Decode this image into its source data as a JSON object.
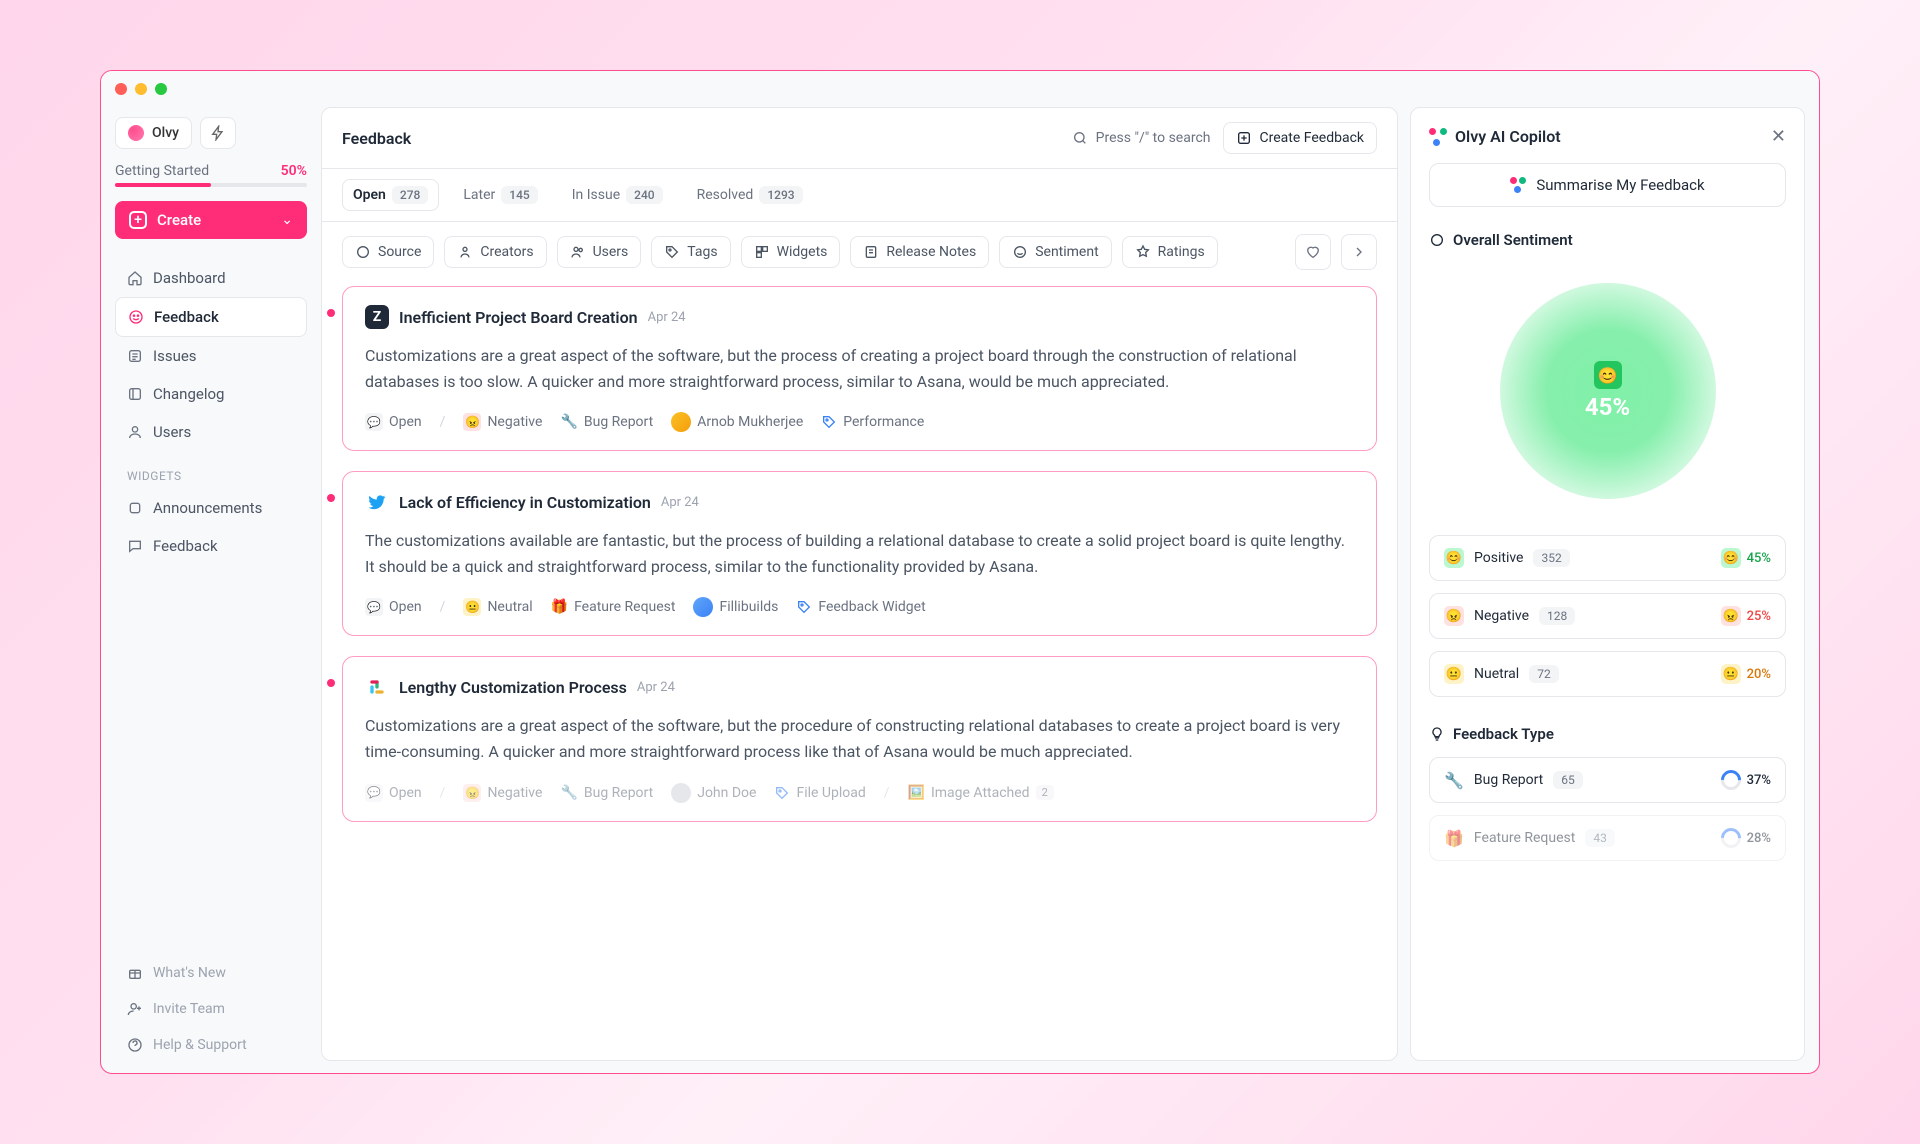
{
  "brand": "Olvy",
  "sidebar": {
    "getting_started": "Getting Started",
    "progress": "50%",
    "create": "Create",
    "nav": [
      {
        "label": "Dashboard"
      },
      {
        "label": "Feedback"
      },
      {
        "label": "Issues"
      },
      {
        "label": "Changelog"
      },
      {
        "label": "Users"
      }
    ],
    "widgets_header": "WIDGETS",
    "widgets": [
      {
        "label": "Announcements"
      },
      {
        "label": "Feedback"
      }
    ],
    "footer": [
      {
        "label": "What's New"
      },
      {
        "label": "Invite Team"
      },
      {
        "label": "Help & Support"
      }
    ]
  },
  "header": {
    "title": "Feedback",
    "search_hint": "Press \"/\" to search",
    "create_btn": "Create Feedback"
  },
  "tabs": [
    {
      "label": "Open",
      "count": "278"
    },
    {
      "label": "Later",
      "count": "145"
    },
    {
      "label": "In Issue",
      "count": "240"
    },
    {
      "label": "Resolved",
      "count": "1293"
    }
  ],
  "filters": [
    "Source",
    "Creators",
    "Users",
    "Tags",
    "Widgets",
    "Release Notes",
    "Sentiment",
    "Ratings"
  ],
  "cards": [
    {
      "title": "Inefficient Project Board Creation",
      "date": "Apr 24",
      "body": "Customizations are a great aspect of the software, but the process of creating a project board through the construction of relational databases is too slow. A quicker and more straightforward process, similar to Asana, would be much appreciated.",
      "status": "Open",
      "sentiment": "Negative",
      "type": "Bug Report",
      "author": "Arnob Mukherjee",
      "tag": "Performance"
    },
    {
      "title": "Lack of Efficiency in Customization",
      "date": "Apr 24",
      "body": "The customizations available are fantastic, but the process of building a relational database to create a solid project board is quite lengthy. It should be a quick and straightforward process, similar to the functionality provided by Asana.",
      "status": "Open",
      "sentiment": "Neutral",
      "type": "Feature Request",
      "author": "Fillibuilds",
      "tag": "Feedback Widget"
    },
    {
      "title": "Lengthy Customization Process",
      "date": "Apr 24",
      "body": "Customizations are a great aspect of the software, but the procedure of constructing relational databases to create a project board is very time-consuming. A quicker and more straightforward process like that of Asana would be much appreciated.",
      "status": "Open",
      "sentiment": "Negative",
      "type": "Bug Report",
      "author": "John Doe",
      "tag": "File Upload",
      "extra": "Image Attached",
      "extra_count": "2"
    }
  ],
  "copilot": {
    "title": "Olvy AI Copilot",
    "summarise": "Summarise My Feedback",
    "overall_header": "Overall Sentiment",
    "gauge_pct": "45%",
    "sentiments": [
      {
        "label": "Positive",
        "count": "352",
        "pct": "45%"
      },
      {
        "label": "Negative",
        "count": "128",
        "pct": "25%"
      },
      {
        "label": "Nuetral",
        "count": "72",
        "pct": "20%"
      }
    ],
    "fb_type_header": "Feedback Type",
    "fb_types": [
      {
        "label": "Bug Report",
        "count": "65",
        "pct": "37%"
      },
      {
        "label": "Feature Request",
        "count": "43",
        "pct": "28%"
      }
    ]
  }
}
